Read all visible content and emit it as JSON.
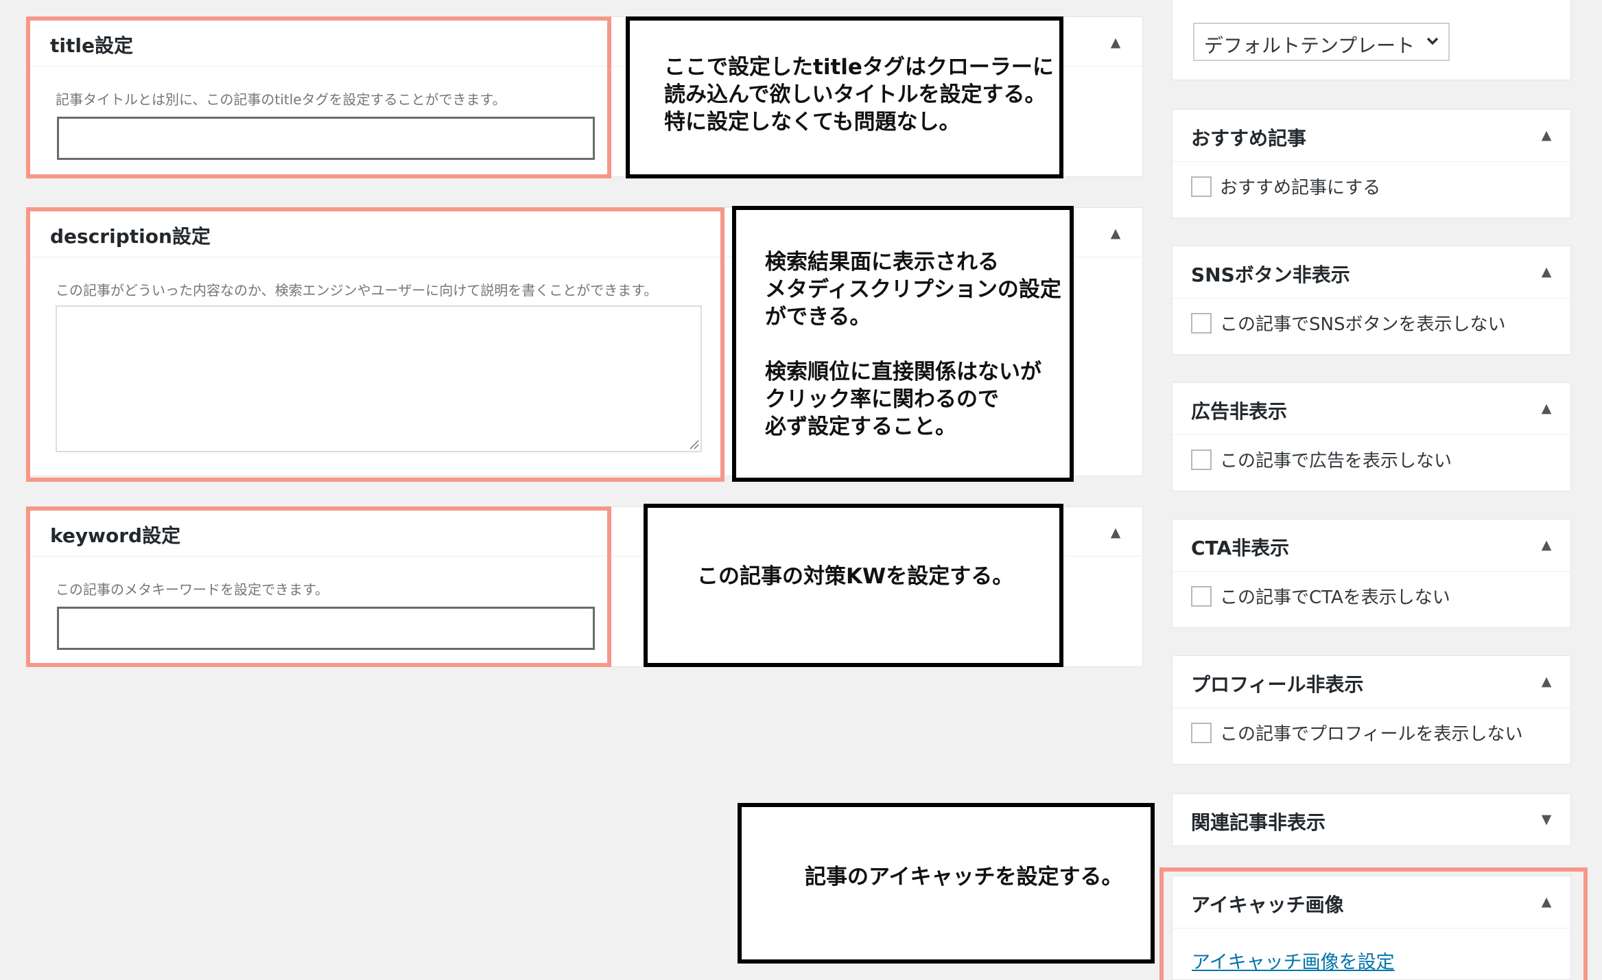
{
  "meta_boxes": {
    "title": {
      "heading": "title設定",
      "description": "記事タイトルとは別に、この記事のtitleタグを設定することができます。",
      "value": ""
    },
    "description": {
      "heading": "description設定",
      "description": "この記事がどういった内容なのか、検索エンジンやユーザーに向けて説明を書くことができます。",
      "value": ""
    },
    "keyword": {
      "heading": "keyword設定",
      "description": "この記事のメタキーワードを設定できます。",
      "value": ""
    }
  },
  "annotations": {
    "title_note": "ここで設定したtitleタグはクローラーに\n読み込んで欲しいタイトルを設定する。\n特に設定しなくても問題なし。",
    "description_note": "検索結果面に表示される\nメタディスクリプションの設定\nができる。\n\n検索順位に直接関係はないが\nクリック率に関わるので\n必ず設定すること。",
    "keyword_note": "この記事の対策KWを設定する。",
    "eyecatch_note": "記事のアイキャッチを設定する。"
  },
  "sidebar": {
    "template_select": {
      "value": "デフォルトテンプレート"
    },
    "boxes": [
      {
        "title": "おすすめ記事",
        "checkbox_label": "おすすめ記事にする",
        "toggle": "▲"
      },
      {
        "title": "SNSボタン非表示",
        "checkbox_label": "この記事でSNSボタンを表示しない",
        "toggle": "▲"
      },
      {
        "title": "広告非表示",
        "checkbox_label": "この記事で広告を表示しない",
        "toggle": "▲"
      },
      {
        "title": "CTA非表示",
        "checkbox_label": "この記事でCTAを表示しない",
        "toggle": "▲"
      },
      {
        "title": "プロフィール非表示",
        "checkbox_label": "この記事でプロフィールを表示しない",
        "toggle": "▲"
      }
    ],
    "related": {
      "title": "関連記事非表示",
      "toggle": "▼"
    },
    "eyecatch": {
      "title": "アイキャッチ画像",
      "toggle": "▲",
      "link": "アイキャッチ画像を設定"
    }
  },
  "toggles": {
    "up": "▲"
  },
  "colors": {
    "highlight": "#f6978a",
    "link": "#0073aa",
    "background": "#f1f1f1"
  }
}
